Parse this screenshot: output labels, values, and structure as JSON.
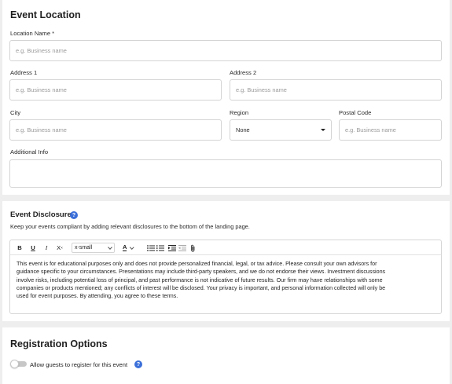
{
  "event_location": {
    "title": "Event Location",
    "location_name": {
      "label": "Location Name *",
      "placeholder": "e.g. Business name"
    },
    "address1": {
      "label": "Address 1",
      "placeholder": "e.g. Business name"
    },
    "address2": {
      "label": "Address 2",
      "placeholder": "e.g. Business name"
    },
    "city": {
      "label": "City",
      "placeholder": "e.g. Business name"
    },
    "region": {
      "label": "Region",
      "value": "None"
    },
    "postal_code": {
      "label": "Postal Code",
      "placeholder": "e.g. Business name"
    },
    "additional_info": {
      "label": "Additional Info",
      "value": ""
    }
  },
  "event_disclosure": {
    "title": "Event Disclosure",
    "help_glyph": "?",
    "subtitle": "Keep your events compliant by adding relevant disclosures to the bottom of the landing page.",
    "toolbar": {
      "bold": "B",
      "underline": "U",
      "italic": "I",
      "clear_format": "X",
      "clear_format_sup": "×",
      "font_size": "x-small",
      "text_color": "A"
    },
    "body_lines": [
      "This event is for educational purposes only and does not provide personalized financial, legal, or tax advice. Please consult your own advisors for",
      "guidance specific to your circumstances. Presentations may include third-party speakers, and we do not endorse their views. Investment discussions",
      "involve risks, including potential loss of principal, and past performance is not indicative of future results. Our firm may have relationships with some",
      "companies or products mentioned; any conflicts of interest will be disclosed. Your privacy is important, and personal information collected will only be",
      "used for event purposes. By attending, you agree to these terms."
    ]
  },
  "registration_options": {
    "title": "Registration Options",
    "help_glyph": "?",
    "allow_guests": {
      "label": "Allow guests to register for this event",
      "enabled": false
    }
  },
  "colors": {
    "accent": "#3b6fd9",
    "page_background": "#eeeeee",
    "card_background": "#ffffff",
    "border": "#d4d4d4",
    "placeholder_text": "#9a9a9a"
  }
}
